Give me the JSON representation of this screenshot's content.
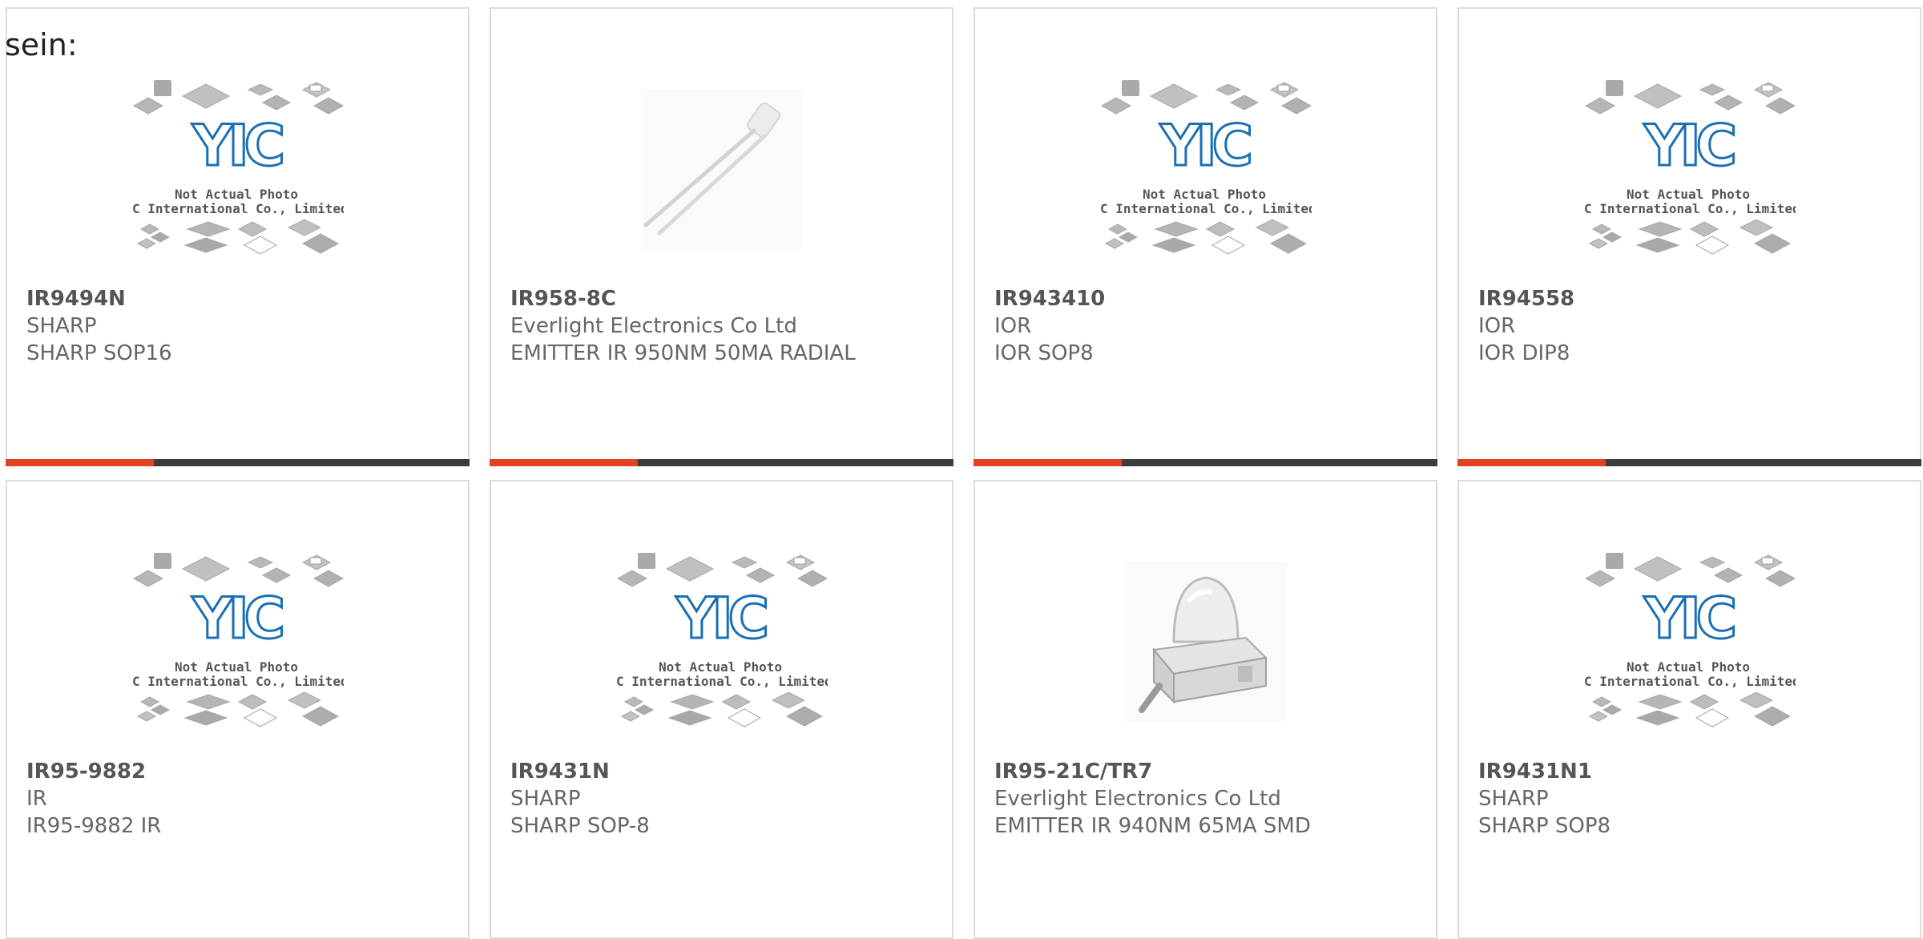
{
  "heading": "sein:",
  "placeholder": {
    "logo": "YIC",
    "line1": "Not Actual Photo",
    "line2": "YIC International Co., Limited."
  },
  "colors": {
    "accent": "#e2401f",
    "bar": "#3c3c3c",
    "logo_blue": "#1a6fb5",
    "border": "#dcdcdc"
  },
  "products": [
    {
      "part": "IR9494N",
      "maker": "SHARP",
      "desc": "SHARP SOP16",
      "image": "placeholder",
      "progress": 0.32
    },
    {
      "part": "IR958-8C",
      "maker": "Everlight Electronics Co Ltd",
      "desc": "EMITTER IR 950NM 50MA RADIAL",
      "image": "radial-led",
      "progress": 0.32
    },
    {
      "part": "IR943410",
      "maker": "IOR",
      "desc": "IOR SOP8",
      "image": "placeholder",
      "progress": 0.32
    },
    {
      "part": "IR94558",
      "maker": "IOR",
      "desc": "IOR DIP8",
      "image": "placeholder",
      "progress": 0.32
    },
    {
      "part": "IR95-9882",
      "maker": "IR",
      "desc": "IR95-9882 IR",
      "image": "placeholder"
    },
    {
      "part": "IR9431N",
      "maker": "SHARP",
      "desc": "SHARP SOP-8",
      "image": "placeholder"
    },
    {
      "part": "IR95-21C/TR7",
      "maker": "Everlight Electronics Co Ltd",
      "desc": "EMITTER IR 940NM 65MA SMD",
      "image": "smd-led"
    },
    {
      "part": "IR9431N1",
      "maker": "SHARP",
      "desc": "SHARP SOP8",
      "image": "placeholder"
    }
  ]
}
